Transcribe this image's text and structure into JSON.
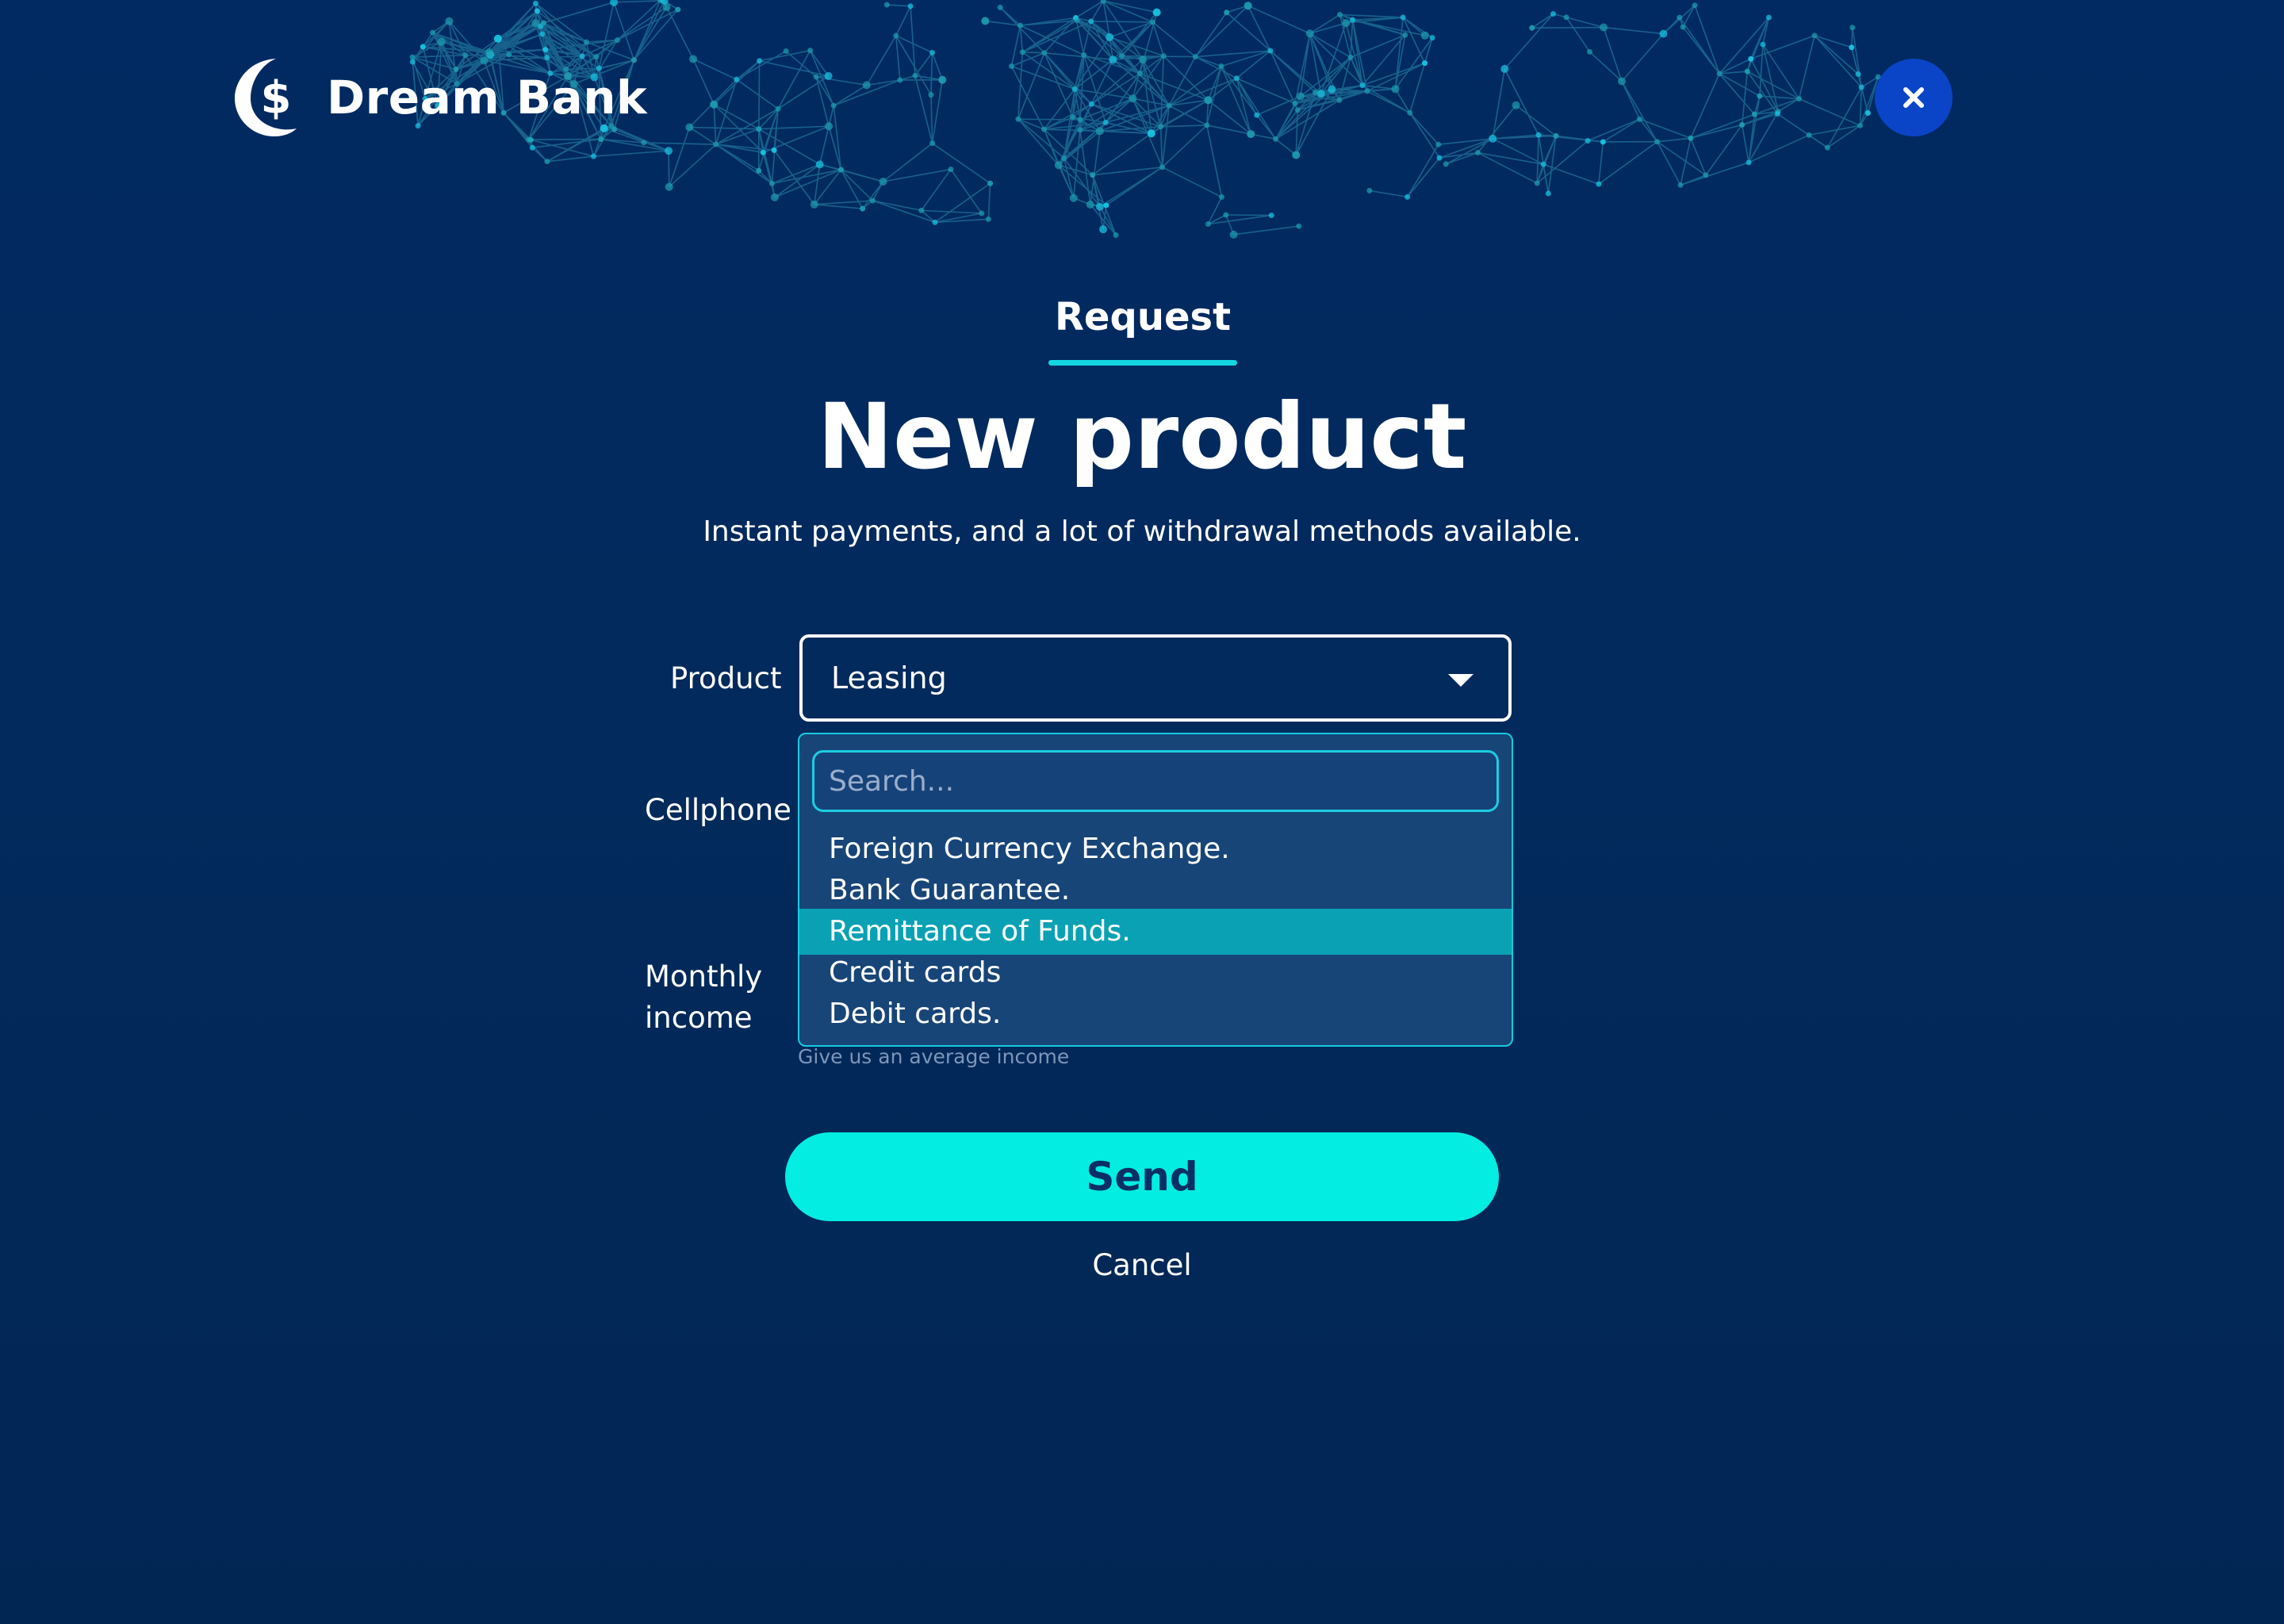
{
  "brand": {
    "name": "Dream Bank",
    "logo_icon": "crescent-dollar-icon",
    "accent_color": "#03ede2"
  },
  "header": {
    "close_icon": "close-icon"
  },
  "tab": {
    "label": "Request"
  },
  "page": {
    "title": "New product",
    "subtitle": "Instant payments, and a lot of withdrawal methods available."
  },
  "form": {
    "product_label": "Product",
    "product_value": "Leasing",
    "cellphone_label": "Cellphone",
    "monthly_income_label_line1": "Monthly",
    "monthly_income_label_line2": "income",
    "income_hint": "Give us an average income"
  },
  "dropdown": {
    "search_placeholder": "Search...",
    "options": [
      {
        "label": "Foreign Currency Exchange."
      },
      {
        "label": "Bank Guarantee."
      },
      {
        "label": "Remittance of Funds."
      },
      {
        "label": "Credit cards"
      },
      {
        "label": "Debit cards."
      }
    ],
    "highlighted_option": "Remittance of Funds."
  },
  "actions": {
    "send_label": "Send",
    "cancel_label": "Cancel"
  }
}
